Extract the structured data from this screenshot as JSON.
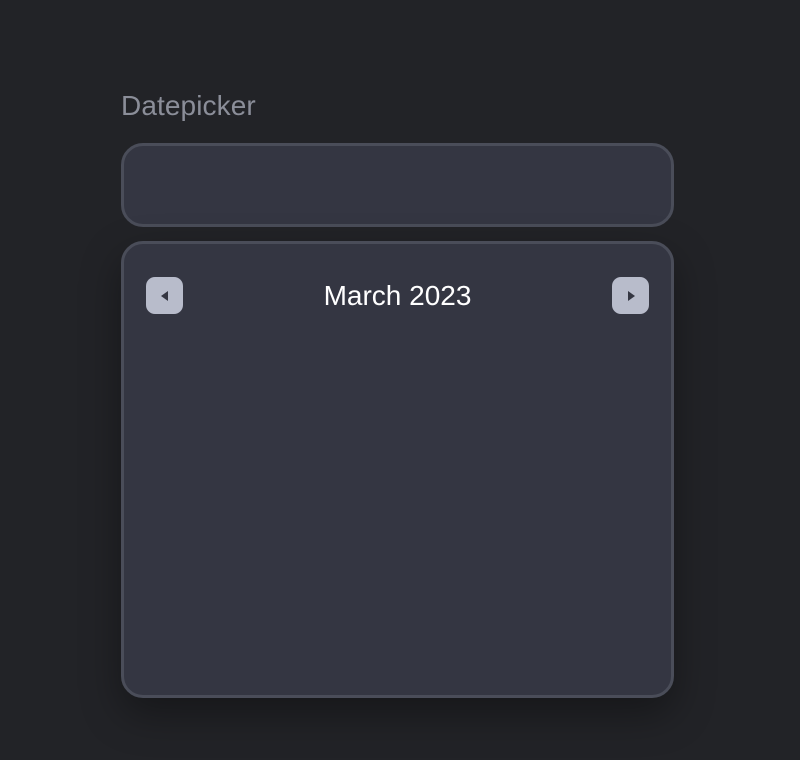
{
  "datepicker": {
    "label": "Datepicker",
    "input_value": "",
    "input_placeholder": ""
  },
  "calendar": {
    "month_title": "March 2023",
    "prev_icon": "caret-left-icon",
    "next_icon": "caret-right-icon"
  },
  "colors": {
    "background": "#222327",
    "panel": "#343642",
    "border": "#4a4d59",
    "label": "#8b8e99",
    "nav_button": "#b8bccb",
    "nav_icon": "#343642",
    "title": "#ffffff"
  }
}
